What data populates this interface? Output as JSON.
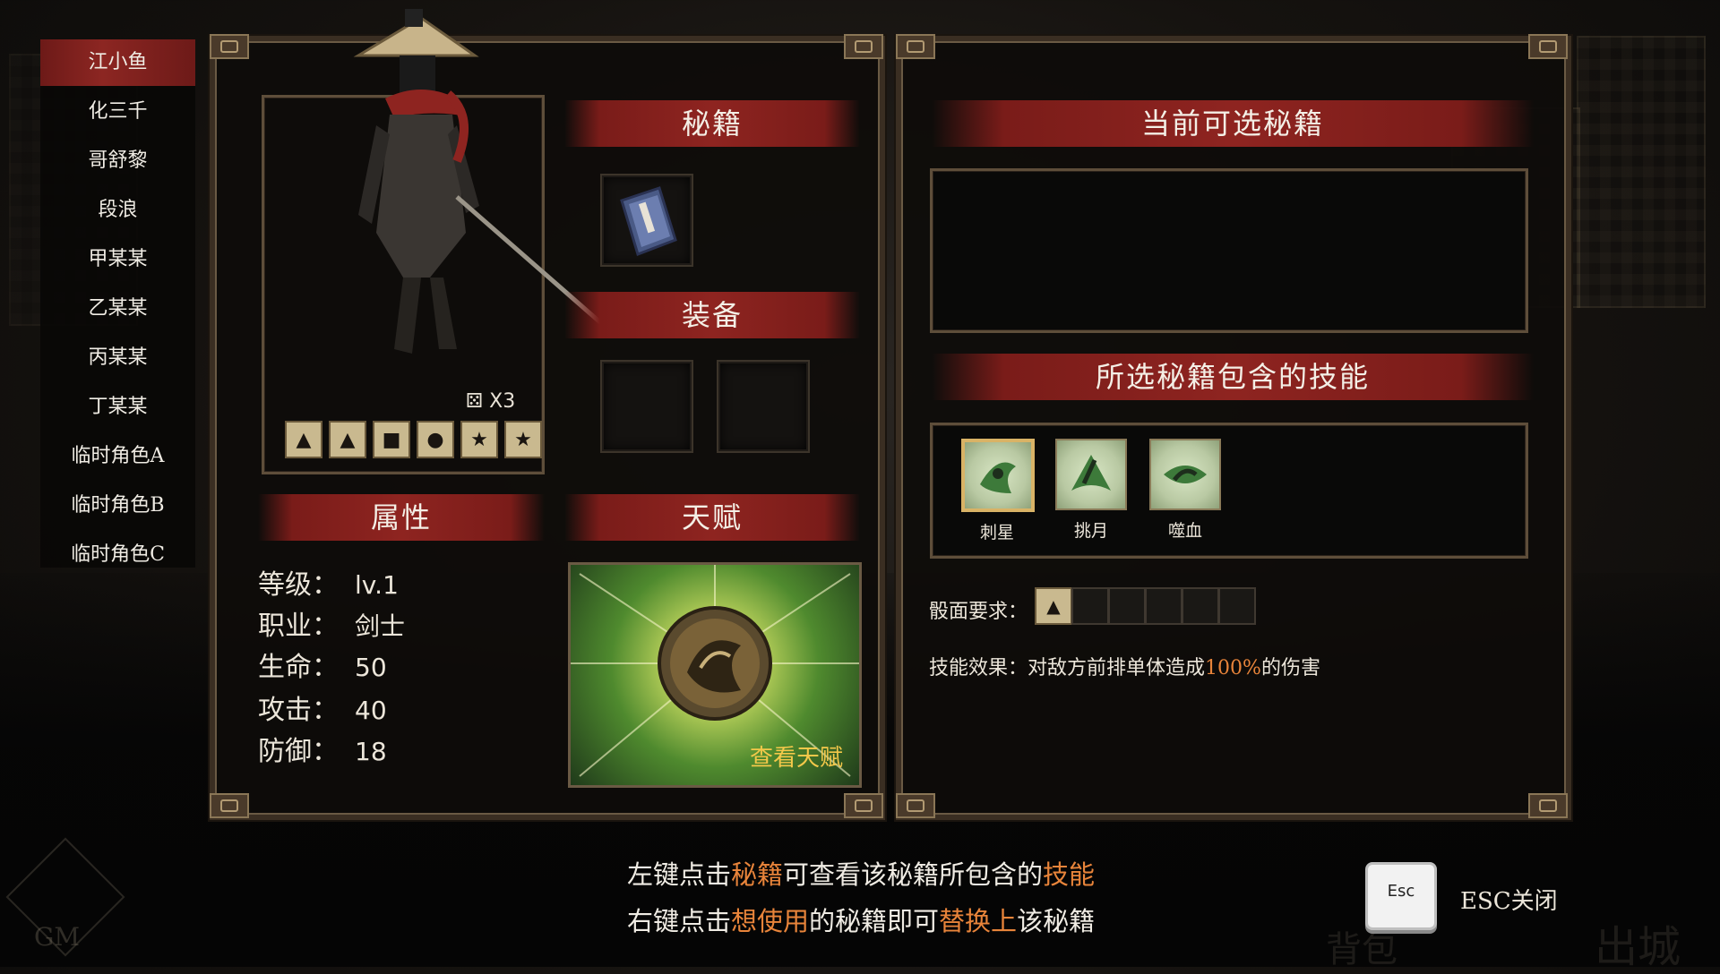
{
  "roster": {
    "items": [
      "江小鱼",
      "化三千",
      "哥舒黎",
      "段浪",
      "甲某某",
      "乙某某",
      "丙某某",
      "丁某某",
      "临时角色A",
      "临时角色B",
      "临时角色C"
    ],
    "active_index": 0
  },
  "character": {
    "dice_count": "X3",
    "dice": [
      {
        "face": "▲",
        "icon": "triangle-icon"
      },
      {
        "face": "▲",
        "icon": "triangle-icon"
      },
      {
        "face": "■",
        "icon": "square-icon"
      },
      {
        "face": "●",
        "icon": "circle-icon"
      },
      {
        "face": "★",
        "icon": "star-icon"
      },
      {
        "face": "★",
        "icon": "star-icon"
      }
    ]
  },
  "sections": {
    "secret_books": "秘籍",
    "equipment": "装备",
    "attributes": "属性",
    "talent": "天赋",
    "available_books": "当前可选秘籍",
    "book_skills": "所选秘籍包含的技能"
  },
  "stats": [
    {
      "label": "等级：",
      "value": "lv.1"
    },
    {
      "label": "职业：",
      "value": "剑士"
    },
    {
      "label": "生命：",
      "value": "50"
    },
    {
      "label": "攻击：",
      "value": "40"
    },
    {
      "label": "防御：",
      "value": "18"
    }
  ],
  "talent": {
    "view_label": "查看天赋"
  },
  "skills": [
    {
      "name": "刺星",
      "active": true
    },
    {
      "name": "挑月",
      "active": false
    },
    {
      "name": "噬血",
      "active": false
    }
  ],
  "requirement": {
    "label": "骰面要求：",
    "slots": [
      "▲",
      "",
      "",
      "",
      "",
      ""
    ]
  },
  "effect": {
    "label": "技能效果：",
    "pre": "对敌方前排单体造成",
    "value": "100%",
    "post": "的伤害"
  },
  "hints": {
    "line1": {
      "a": "左键点击",
      "b": "秘籍",
      "c": "可查看该秘籍所包含的",
      "d": "技能"
    },
    "line2": {
      "a": "右键点击",
      "b": "想使用",
      "c": "的秘籍即可",
      "d": "替换上",
      "e": "该秘籍"
    }
  },
  "esc": {
    "key": "Esc",
    "label": "ESC关闭"
  },
  "gm_text": "GM",
  "bg_nav": [
    "背包",
    "出城"
  ],
  "colors": {
    "accent_red": "#8e2420",
    "highlight_orange": "#e8843a",
    "gold": "#f4c84a"
  }
}
